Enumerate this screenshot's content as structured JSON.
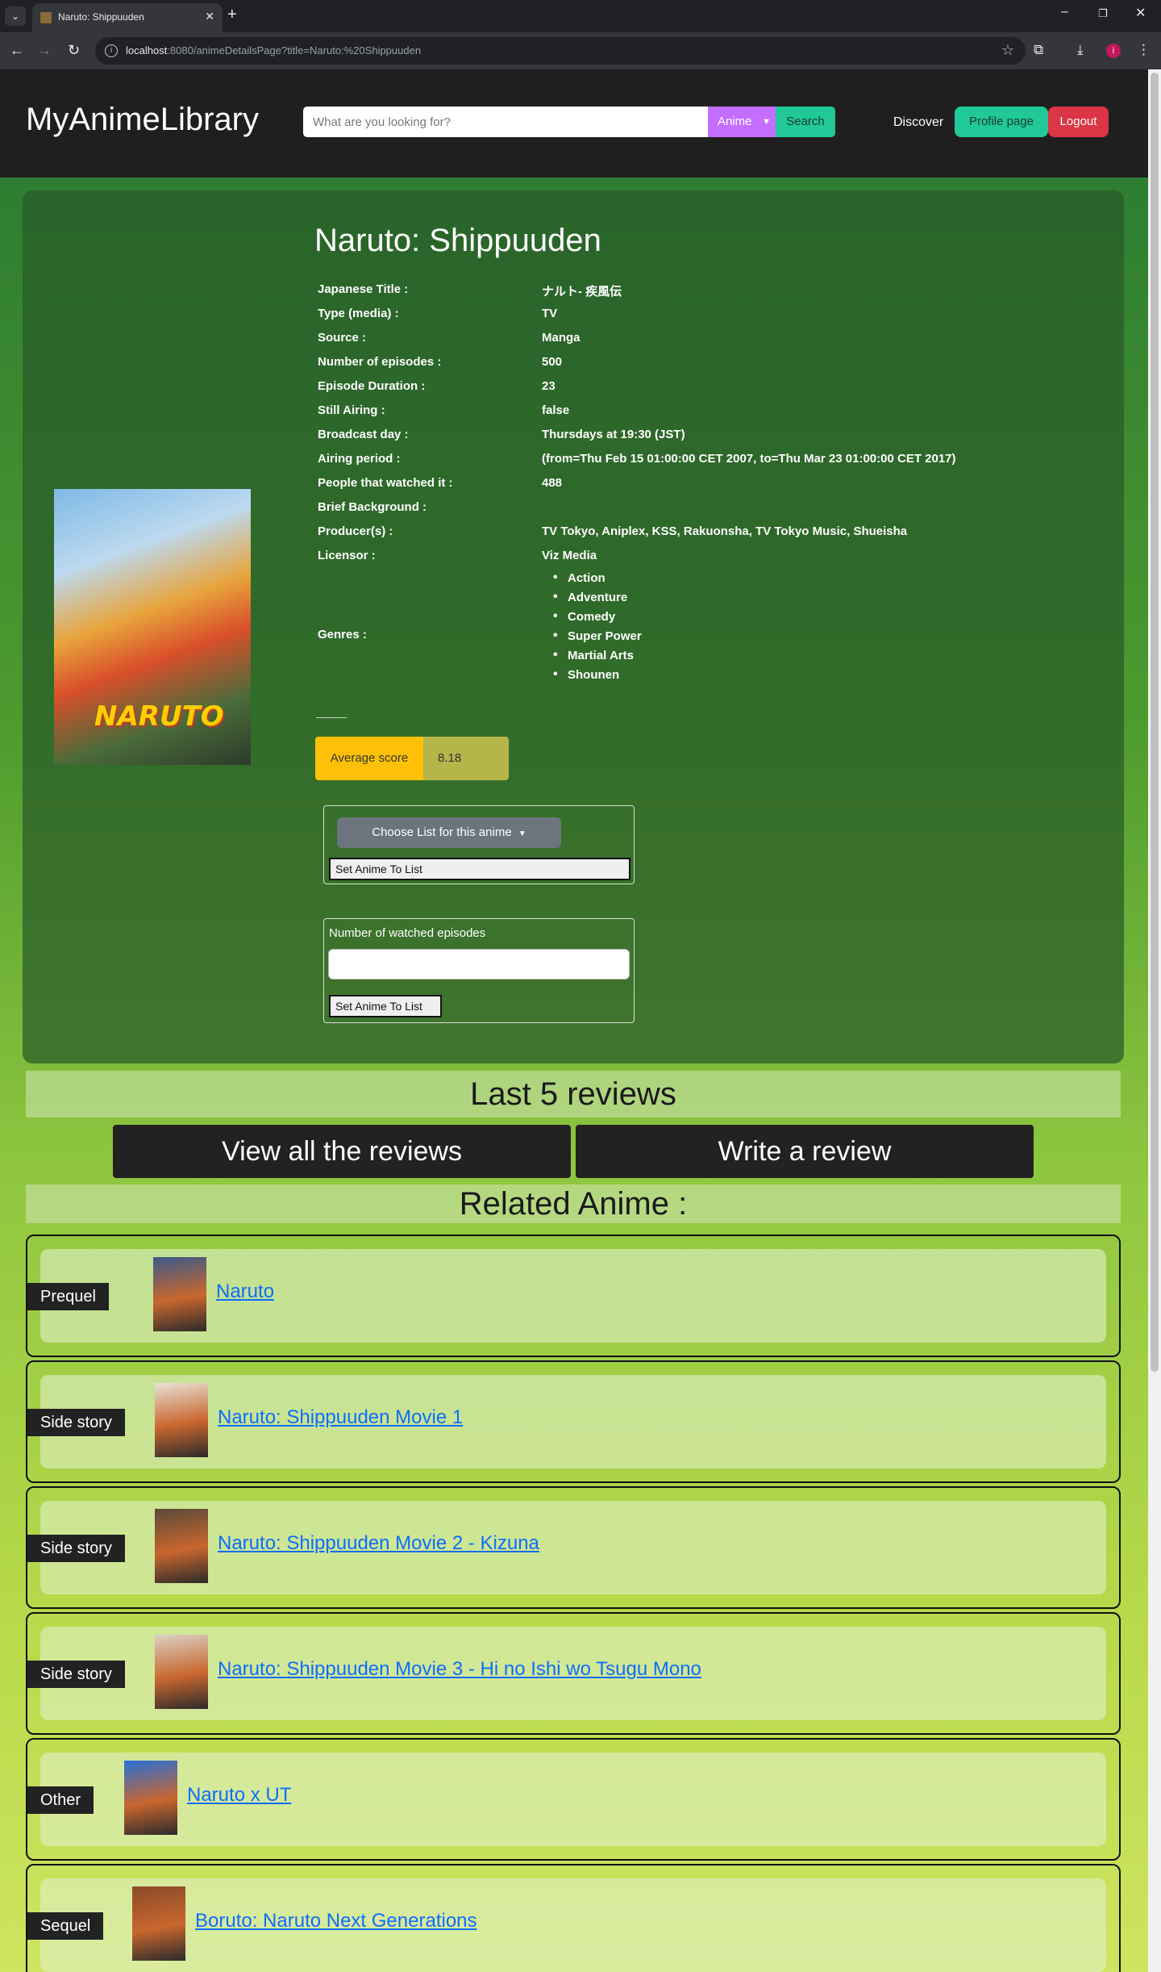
{
  "browser": {
    "tab_title": "Naruto: Shippuuden",
    "url_host": "localhost",
    "url_rest": ":8080/animeDetailsPage?title=Naruto:%20Shippuuden",
    "profile_initial": "i"
  },
  "header": {
    "brand": "MyAnimeLibrary",
    "search_placeholder": "What are you looking for?",
    "search_category": "Anime",
    "search_button": "Search",
    "discover": "Discover",
    "profile_button": "Profile page",
    "logout_button": "Logout"
  },
  "anime": {
    "title": "Naruto: Shippuuden",
    "details": [
      {
        "label": "Japanese Title :",
        "value": "ナルト- 疾風伝"
      },
      {
        "label": "Type (media) :",
        "value": "TV"
      },
      {
        "label": "Source :",
        "value": "Manga"
      },
      {
        "label": "Number of episodes :",
        "value": "500"
      },
      {
        "label": "Episode Duration :",
        "value": "23"
      },
      {
        "label": "Still Airing :",
        "value": "false"
      },
      {
        "label": "Broadcast day :",
        "value": "Thursdays at 19:30 (JST)"
      },
      {
        "label": "Airing period :",
        "value": "(from=Thu Feb 15 01:00:00 CET 2007, to=Thu Mar 23 01:00:00 CET 2017)"
      },
      {
        "label": "People that watched it :",
        "value": "488"
      },
      {
        "label": "Brief Background :",
        "value": ""
      },
      {
        "label": "Producer(s) :",
        "value": "TV Tokyo, Aniplex, KSS, Rakuonsha, TV Tokyo Music, Shueisha"
      },
      {
        "label": "Licensor :",
        "value": "Viz Media"
      }
    ],
    "genres_label": "Genres :",
    "genres": [
      "Action",
      "Adventure",
      "Comedy",
      "Super Power",
      "Martial Arts",
      "Shounen"
    ],
    "score_label": "Average score",
    "score_value": "8.18",
    "poster_logo": "NARUTO"
  },
  "list_form": {
    "choose_button": "Choose List for this anime",
    "set_button": "Set Anime To List"
  },
  "episodes_form": {
    "label": "Number of watched episodes",
    "set_button": "Set Anime To List"
  },
  "reviews": {
    "heading": "Last 5 reviews",
    "view_all": "View all the reviews",
    "write": "Write a review"
  },
  "related": {
    "heading": "Related Anime :",
    "items": [
      {
        "relation": "Prequel",
        "title": "Naruto",
        "thumb_color": "#3b5a8a"
      },
      {
        "relation": "Side story",
        "title": "Naruto: Shippuuden Movie 1",
        "thumb_color": "#e8e2d6"
      },
      {
        "relation": "Side story",
        "title": "Naruto: Shippuuden Movie 2 - Kizuna",
        "thumb_color": "#5a4a3a"
      },
      {
        "relation": "Side story",
        "title": "Naruto: Shippuuden Movie 3 - Hi no Ishi wo Tsugu Mono",
        "thumb_color": "#d9d2c5"
      },
      {
        "relation": "Other",
        "title": "Naruto x UT",
        "thumb_color": "#2a6fd6"
      },
      {
        "relation": "Sequel",
        "title": "Boruto: Naruto Next Generations",
        "thumb_color": "#8a4a2a"
      }
    ]
  },
  "colors": {
    "accent_teal": "#20c997",
    "accent_purple": "#c46dff",
    "danger": "#dc3545",
    "score_yellow": "#ffc107",
    "link_blue": "#0d6efd"
  }
}
